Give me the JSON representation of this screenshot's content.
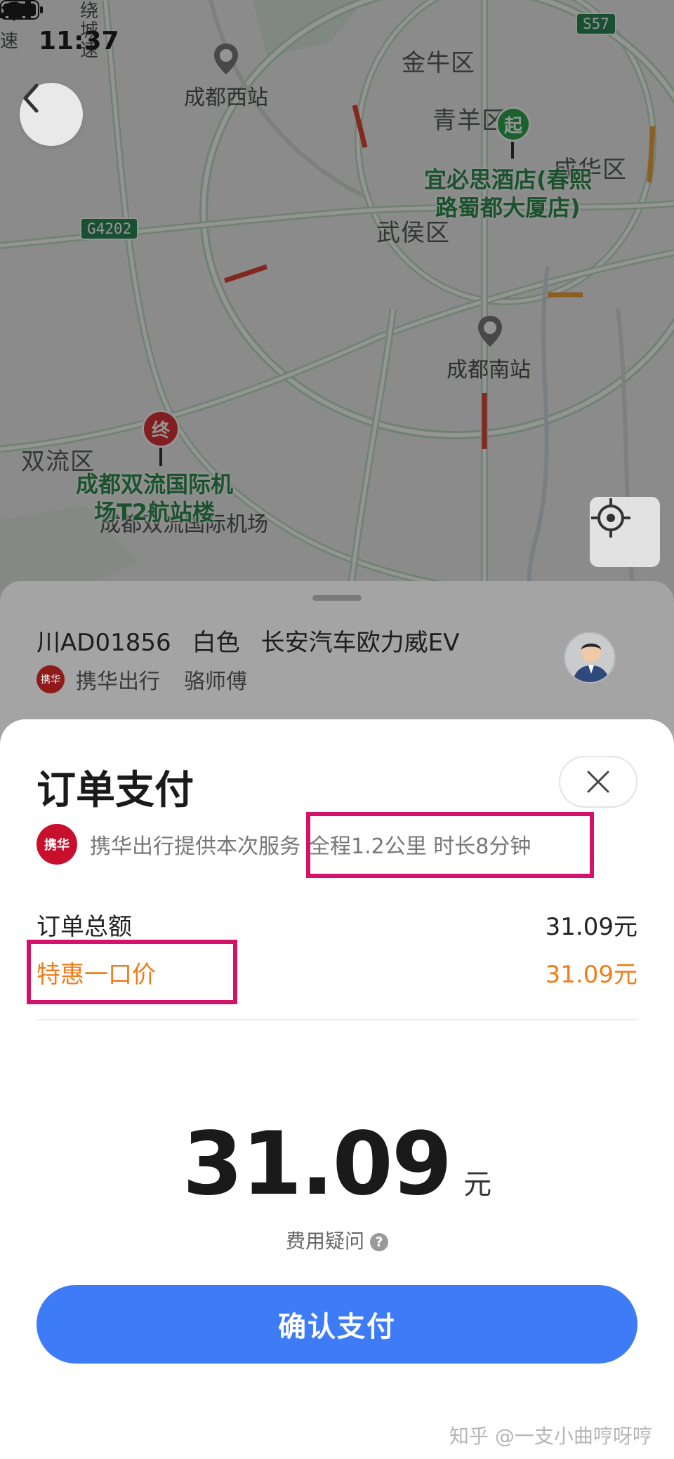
{
  "status_bar": {
    "time": "11:37"
  },
  "map": {
    "districts": [
      "金牛区",
      "青羊区",
      "成华区",
      "武侯区",
      "双流区"
    ],
    "stations": [
      "成都西站",
      "成都南站",
      "成都双流国际机场"
    ],
    "road_badges": [
      "G4202",
      "S57"
    ],
    "start_marker": "起",
    "end_marker": "终",
    "start_poi": [
      "宜必思酒店(春熙",
      "路蜀都大厦店)"
    ],
    "end_poi": [
      "成都双流国际机",
      "场T2航站楼"
    ],
    "edge_text": [
      "绕",
      "城",
      "速",
      "速"
    ]
  },
  "driver": {
    "plate": "川AD01856",
    "color": "白色",
    "model": "长安汽车欧力威EV",
    "company": "携华出行",
    "name": "骆师傅",
    "logo_text": "携华"
  },
  "payment": {
    "title": "订单支付",
    "provider_logo": "携华",
    "provider_text": "携华出行提供本次服务",
    "trip_info": "全程1.2公里 时长8分钟",
    "total_label": "订单总额",
    "total_value": "31.09元",
    "discount_label": "特惠一口价",
    "discount_value": "31.09元",
    "amount": "31.09",
    "amount_unit": "元",
    "fee_question": "费用疑问",
    "question_mark": "?",
    "confirm_label": "确认支付"
  },
  "watermark": "知乎 @一支小曲哼呀哼",
  "colors": {
    "accent_blue": "#3d7bf7",
    "discount_orange": "#ee7d1a",
    "highlight_magenta": "#d3136a",
    "provider_red": "#c8102e"
  }
}
